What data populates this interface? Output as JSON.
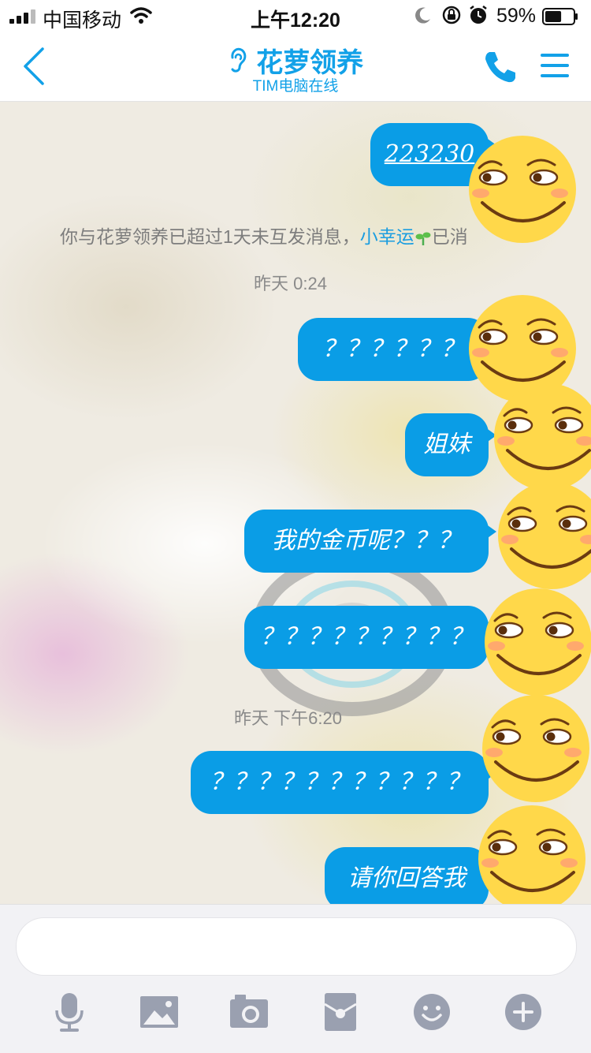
{
  "status_bar": {
    "carrier": "中国移动",
    "time": "上午12:20",
    "battery": "59%",
    "battery_level": 0.59
  },
  "nav": {
    "title": "花萝领养",
    "subtitle": "TIM电脑在线",
    "accent_color": "#12a1e8"
  },
  "chat": {
    "messages": [
      {
        "text": "223230"
      },
      {
        "text": "？？？？？？"
      },
      {
        "text": "姐妹"
      },
      {
        "text": "我的金币呢？？？"
      },
      {
        "text": "？？？？？？？？？"
      },
      {
        "text": "？？？？？？？？？？？"
      },
      {
        "text": "请你回答我"
      }
    ],
    "system_message": {
      "prefix": "你与花萝领养已超过1天未互发消息，",
      "lucky": "小幸运",
      "suffix": "已消"
    },
    "timestamps": [
      "昨天 0:24",
      "昨天 下午6:20"
    ],
    "bubble_color": "#0a9de6"
  },
  "icons": {
    "back": "back-chevron-icon",
    "ear": "ear-icon",
    "phone": "phone-icon",
    "menu": "menu-icon",
    "microphone": "microphone-icon",
    "image": "image-icon",
    "camera": "camera-icon",
    "red_packet": "red-packet-icon",
    "emoji": "emoji-icon",
    "plus": "plus-icon"
  }
}
